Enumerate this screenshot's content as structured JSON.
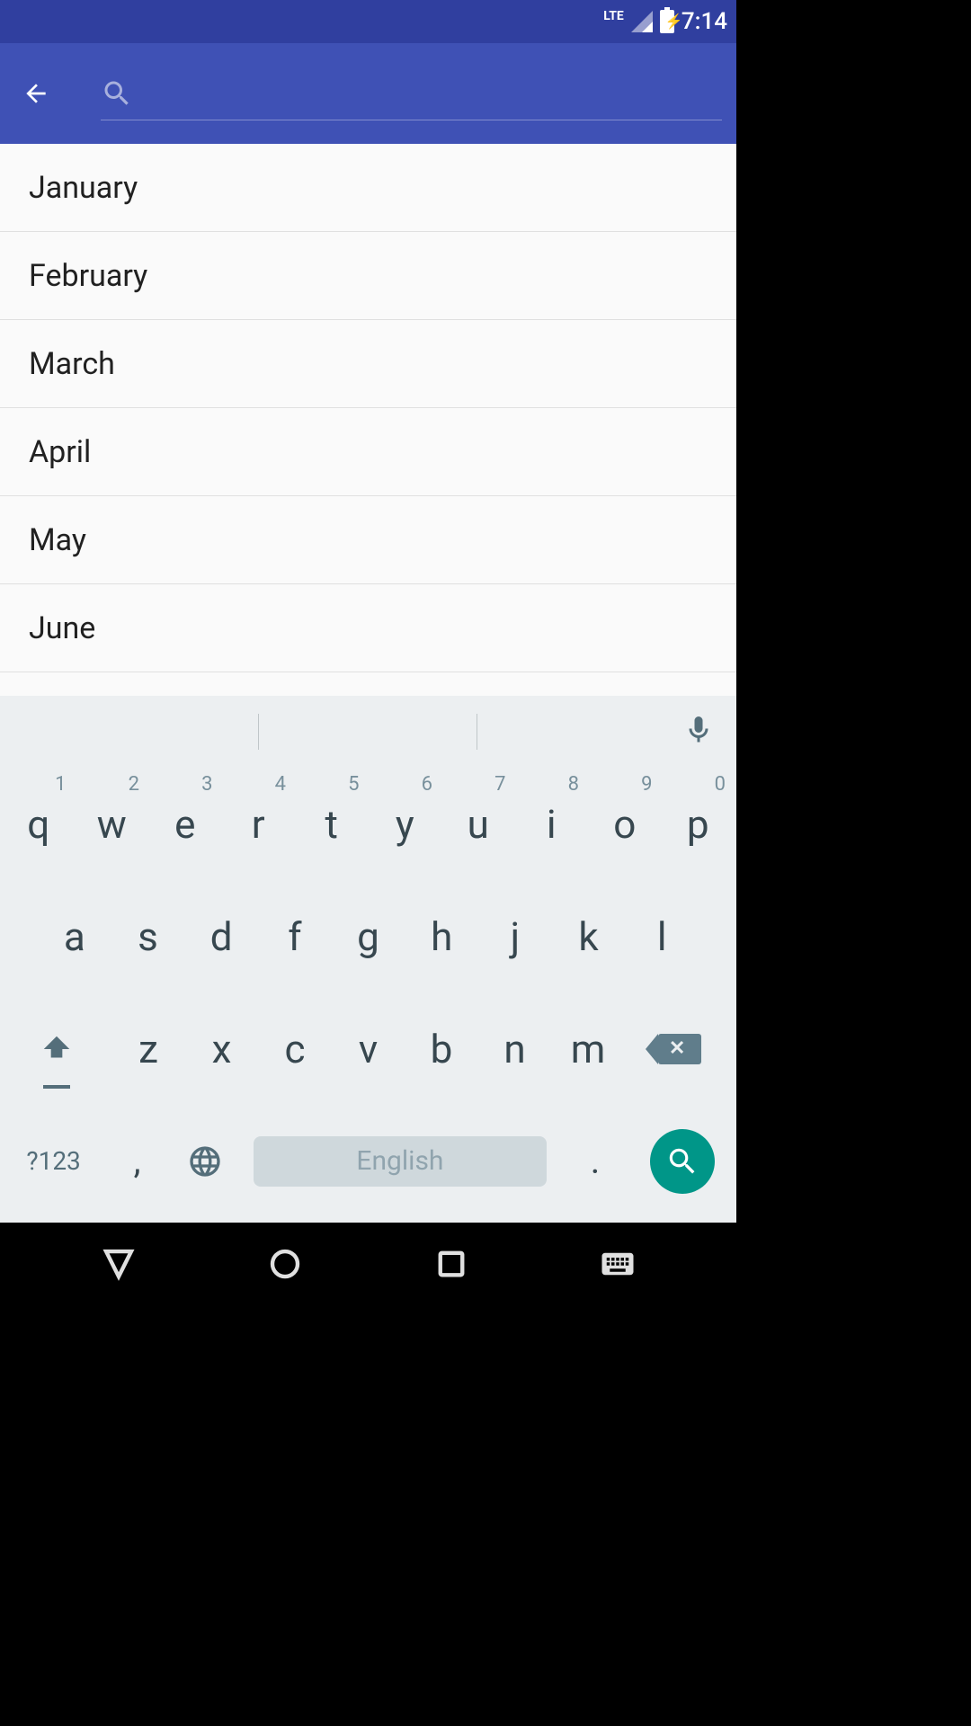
{
  "statusbar": {
    "network": "LTE",
    "time": "7:14"
  },
  "appbar": {
    "back_icon": "back-arrow",
    "search_value": "",
    "search_placeholder": ""
  },
  "list": {
    "items": [
      {
        "label": "January"
      },
      {
        "label": "February"
      },
      {
        "label": "March"
      },
      {
        "label": "April"
      },
      {
        "label": "May"
      },
      {
        "label": "June"
      }
    ]
  },
  "keyboard": {
    "row1": [
      {
        "key": "q",
        "hint": "1"
      },
      {
        "key": "w",
        "hint": "2"
      },
      {
        "key": "e",
        "hint": "3"
      },
      {
        "key": "r",
        "hint": "4"
      },
      {
        "key": "t",
        "hint": "5"
      },
      {
        "key": "y",
        "hint": "6"
      },
      {
        "key": "u",
        "hint": "7"
      },
      {
        "key": "i",
        "hint": "8"
      },
      {
        "key": "o",
        "hint": "9"
      },
      {
        "key": "p",
        "hint": "0"
      }
    ],
    "row2": [
      {
        "key": "a"
      },
      {
        "key": "s"
      },
      {
        "key": "d"
      },
      {
        "key": "f"
      },
      {
        "key": "g"
      },
      {
        "key": "h"
      },
      {
        "key": "j"
      },
      {
        "key": "k"
      },
      {
        "key": "l"
      }
    ],
    "row3": [
      {
        "key": "z"
      },
      {
        "key": "x"
      },
      {
        "key": "c"
      },
      {
        "key": "v"
      },
      {
        "key": "b"
      },
      {
        "key": "n"
      },
      {
        "key": "m"
      }
    ],
    "row4": {
      "symbols": "?123",
      "comma": ",",
      "globe": "globe-icon",
      "space": "English",
      "period": ".",
      "action": "search-icon"
    },
    "mic": "mic-icon"
  },
  "navbar": {
    "back": "nav-back",
    "home": "nav-home",
    "recent": "nav-recent",
    "ime": "nav-ime"
  },
  "colors": {
    "primary": "#3f51b5",
    "primaryDark": "#303f9f",
    "accent": "#009688"
  }
}
